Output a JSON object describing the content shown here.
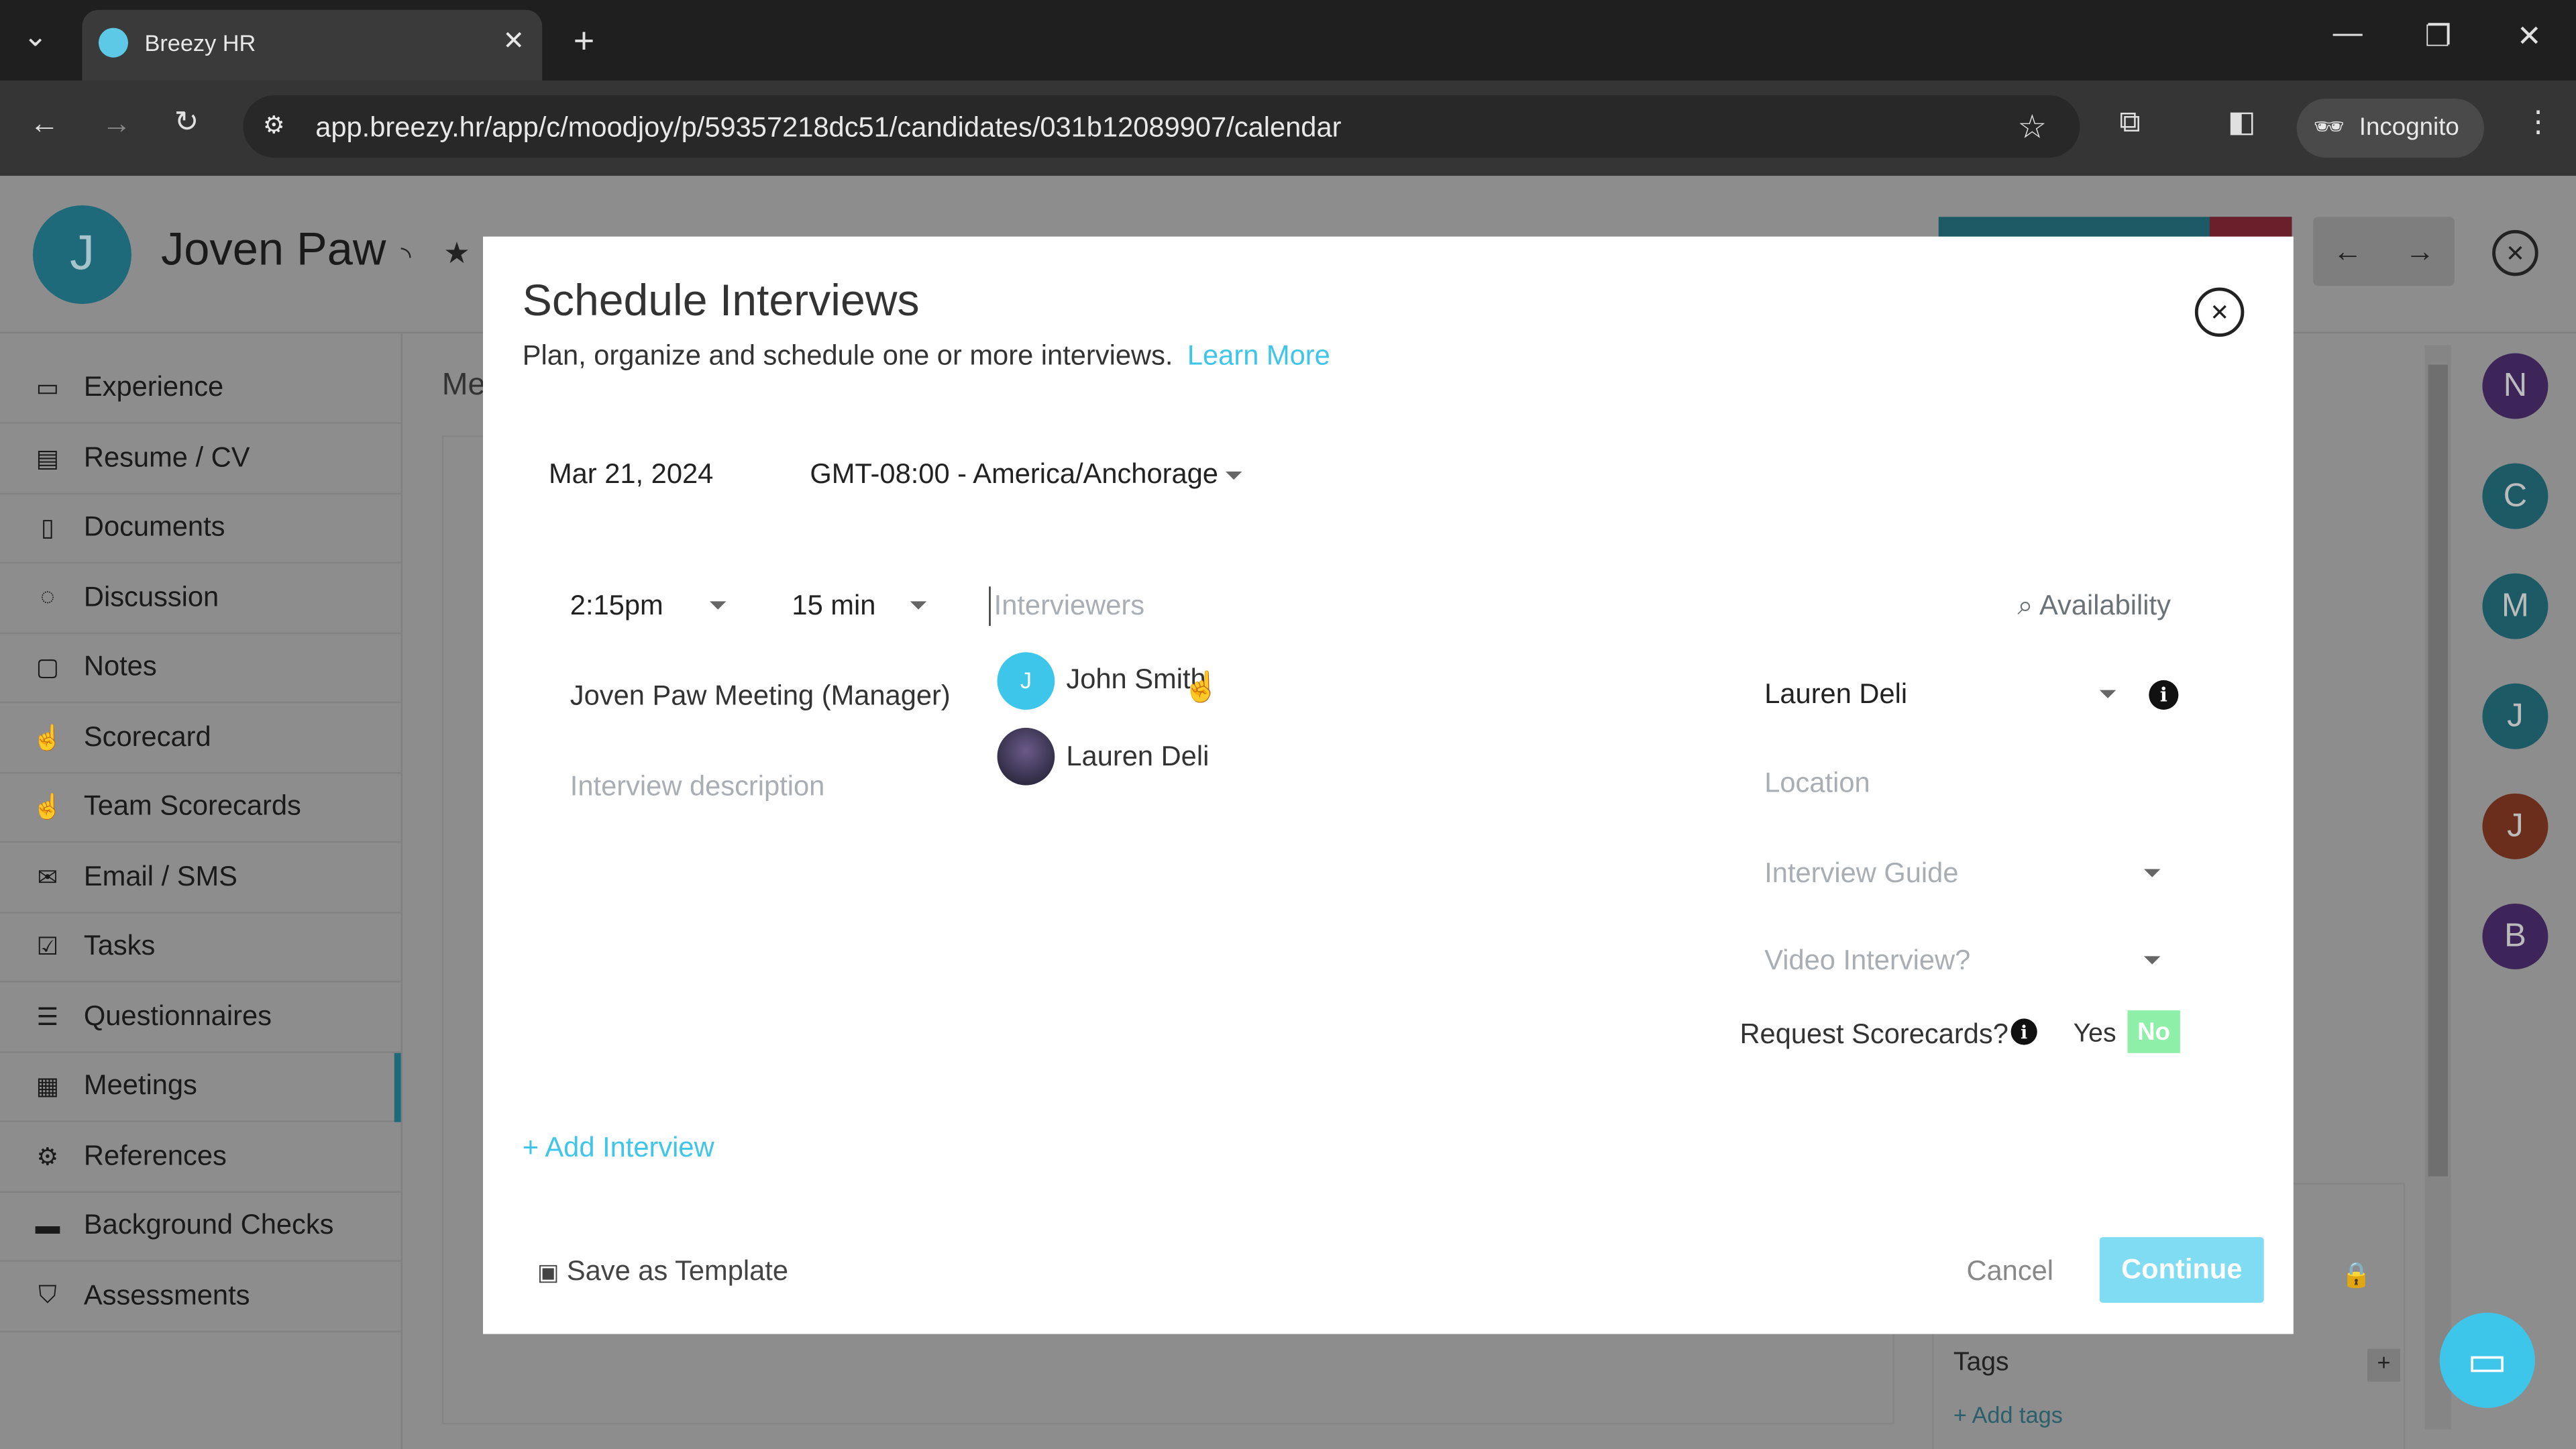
{
  "browser": {
    "tab_title": "Breezy HR",
    "url": "app.breezy.hr/app/c/moodjoy/p/59357218dc51/candidates/031b12089907/calendar",
    "incognito_label": "Incognito"
  },
  "candidate": {
    "initial": "J",
    "name": "Joven Paw",
    "section_heading_partial": "Me"
  },
  "sidebar": {
    "items": [
      {
        "label": "Experience",
        "icon": "briefcase-icon"
      },
      {
        "label": "Resume / CV",
        "icon": "document-icon"
      },
      {
        "label": "Documents",
        "icon": "file-icon"
      },
      {
        "label": "Discussion",
        "icon": "chat-icon"
      },
      {
        "label": "Notes",
        "icon": "note-icon"
      },
      {
        "label": "Scorecard",
        "icon": "thumbs-up-icon"
      },
      {
        "label": "Team Scorecards",
        "icon": "thumbs-up-icon"
      },
      {
        "label": "Email / SMS",
        "icon": "envelope-icon"
      },
      {
        "label": "Tasks",
        "icon": "checkbox-icon"
      },
      {
        "label": "Questionnaires",
        "icon": "list-icon"
      },
      {
        "label": "Meetings",
        "icon": "calendar-icon",
        "active": true
      },
      {
        "label": "References",
        "icon": "gear-icon"
      },
      {
        "label": "Background Checks",
        "icon": "id-card-icon"
      },
      {
        "label": "Assessments",
        "icon": "shield-icon"
      }
    ]
  },
  "team_avatars": [
    {
      "initial": "N",
      "color": "#3e2559"
    },
    {
      "initial": "C",
      "color": "#1c5a66"
    },
    {
      "initial": "M",
      "color": "#1c5a66"
    },
    {
      "initial": "J",
      "color": "#1c5a66"
    },
    {
      "initial": "J",
      "color": "#6b2e1c"
    },
    {
      "initial": "B",
      "color": "#3e2559"
    }
  ],
  "right_panel": {
    "tags_label": "Tags",
    "add_tags": "+ Add tags"
  },
  "modal": {
    "title": "Schedule Interviews",
    "subtitle": "Plan, organize and schedule one or more interviews.",
    "learn_more": "Learn More",
    "date": "Mar 21, 2024",
    "timezone": "GMT-08:00 - America/Anchorage",
    "time": "2:15pm",
    "duration": "15 min",
    "interviewers_placeholder": "Interviewers",
    "availability": "Availability",
    "meeting_title": "Joven Paw Meeting (Manager)",
    "description_placeholder": "Interview description",
    "interviewer_options": [
      {
        "initial": "J",
        "name": "John Smith"
      },
      {
        "initial": "",
        "name": "Lauren Deli"
      }
    ],
    "organizer": "Lauren Deli",
    "location_placeholder": "Location",
    "guide_placeholder": "Interview Guide",
    "video_placeholder": "Video Interview?",
    "request_scorecards_label": "Request Scorecards?",
    "yes": "Yes",
    "no": "No",
    "scorecards_selected": "No",
    "add_interview": "Add Interview",
    "save_template": "Save as Template",
    "cancel": "Cancel",
    "continue": "Continue",
    "accent": "#3ec6ea",
    "toggle_color": "#8ef0a8"
  }
}
